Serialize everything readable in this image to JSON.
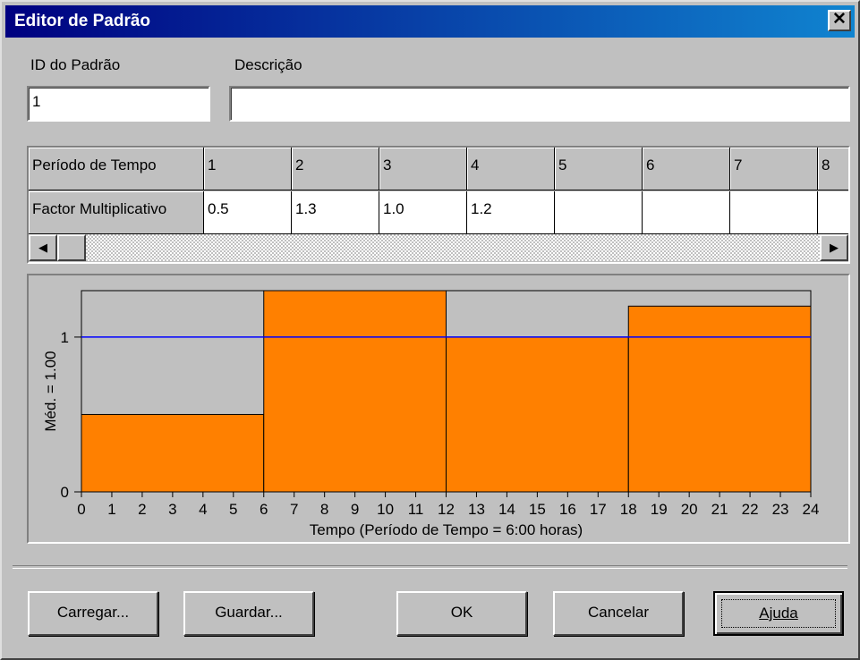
{
  "window": {
    "title": "Editor de Padrão",
    "close_symbol": "✕"
  },
  "form": {
    "id_label": "ID do Padrão",
    "id_value": "1",
    "desc_label": "Descrição",
    "desc_value": ""
  },
  "grid": {
    "row1_header": "Período de Tempo",
    "row2_header": "Factor Multiplicativo",
    "periods": [
      "1",
      "2",
      "3",
      "4",
      "5",
      "6",
      "7",
      "8"
    ],
    "multipliers": [
      "0.5",
      "1.3",
      "1.0",
      "1.2",
      "",
      "",
      "",
      ""
    ],
    "scroll_left": "◀",
    "scroll_right": "▶"
  },
  "chart_data": {
    "type": "bar",
    "x_ticks": [
      "0",
      "1",
      "2",
      "3",
      "4",
      "5",
      "6",
      "7",
      "8",
      "9",
      "10",
      "11",
      "12",
      "13",
      "14",
      "15",
      "16",
      "17",
      "18",
      "19",
      "20",
      "21",
      "22",
      "23",
      "24"
    ],
    "y_ticks": [
      "0",
      "1"
    ],
    "steps": [
      {
        "start": 0,
        "end": 6,
        "value": 0.5
      },
      {
        "start": 6,
        "end": 12,
        "value": 1.3
      },
      {
        "start": 12,
        "end": 18,
        "value": 1.0
      },
      {
        "start": 18,
        "end": 24,
        "value": 1.2
      }
    ],
    "average": 1.0,
    "ylim": [
      0,
      1.3
    ],
    "xlim": [
      0,
      24
    ],
    "xlabel": "Tempo (Período de Tempo = 6:00  horas)",
    "ylabel": "Méd. = 1.00",
    "bar_color": "#ff8000",
    "avg_line_color": "#0000ff",
    "plot_bg": "#c0c0c0"
  },
  "buttons": {
    "load": "Carregar...",
    "save": "Guardar...",
    "ok": "OK",
    "cancel": "Cancelar",
    "help": "Ajuda"
  }
}
